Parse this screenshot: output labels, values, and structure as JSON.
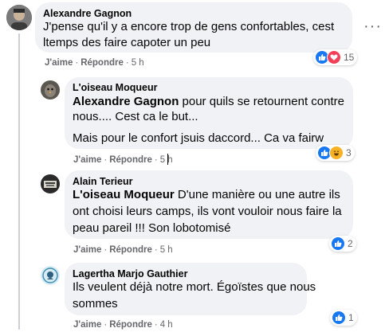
{
  "comments": [
    {
      "author": "Alexandre Gagnon",
      "mention": "",
      "lines": [
        "J'pense qu'il y a encore trop de gens confortables, cest",
        "ltemps des faire capoter un peu"
      ],
      "like": "J'aime",
      "reply": "Répondre",
      "time": "5 h",
      "reaction_count": "15"
    },
    {
      "author": "L'oiseau Moqueur",
      "mention": "Alexandre Gagnon",
      "lines": [
        " pour quils se retournent contre",
        "nous.... Cest ca le but...",
        "Mais pour le confort jsuis daccord... Ca va fairw"
      ],
      "like": "J'aime",
      "reply": "Répondre",
      "time": "5 h",
      "reaction_count": "3"
    },
    {
      "author": "Alain Terieur",
      "mention": "L'oiseau Moqueur",
      "lines": [
        " D'une manière ou une autre ils",
        "ont choisi leurs camps, ils vont vouloir nous faire la",
        "peau pareil !!! Son lobotomisé"
      ],
      "like": "J'aime",
      "reply": "Répondre",
      "time": "5 h",
      "reaction_count": "2"
    },
    {
      "author": "Lagertha Marjo Gauthier",
      "mention": "",
      "lines": [
        "Ils veulent déjà notre mort. Égoïstes que nous",
        "sommes"
      ],
      "like": "J'aime",
      "reply": "Répondre",
      "time": "4 h",
      "reaction_count": "1"
    }
  ],
  "icons": {
    "like": "thumbs-up",
    "love": "heart",
    "haha": "laughing-face",
    "more": "more-options"
  },
  "colors": {
    "like_blue": "#1877f2",
    "love_red": "#f33e58",
    "haha_yellow": "#f7b125",
    "bubble": "#f0f2f5",
    "meta_gray": "#65676b"
  }
}
